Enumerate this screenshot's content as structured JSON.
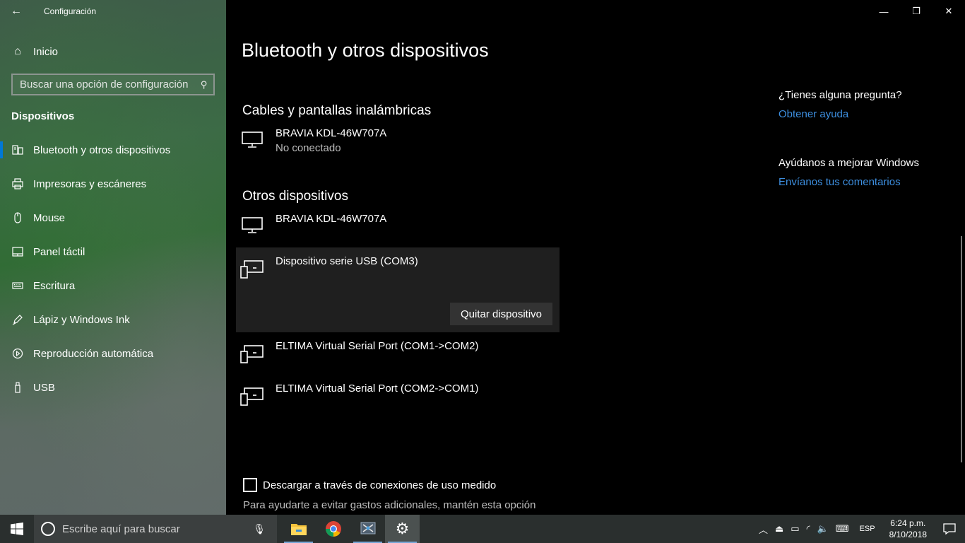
{
  "window": {
    "title": "Configuración",
    "back_icon": "←",
    "minimize_icon": "—",
    "maximize_icon": "❐",
    "close_icon": "✕"
  },
  "sidebar": {
    "home_label": "Inicio",
    "search_placeholder": "Buscar una opción de configuración",
    "section": "Dispositivos",
    "items": [
      {
        "label": "Bluetooth y otros dispositivos",
        "icon": "bluetooth-devices-icon",
        "active": true
      },
      {
        "label": "Impresoras y escáneres",
        "icon": "printer-icon"
      },
      {
        "label": "Mouse",
        "icon": "mouse-icon"
      },
      {
        "label": "Panel táctil",
        "icon": "touchpad-icon"
      },
      {
        "label": "Escritura",
        "icon": "keyboard-icon"
      },
      {
        "label": "Lápiz y Windows Ink",
        "icon": "pen-icon"
      },
      {
        "label": "Reproducción automática",
        "icon": "autoplay-icon"
      },
      {
        "label": "USB",
        "icon": "usb-icon"
      }
    ]
  },
  "main": {
    "title": "Bluetooth y otros dispositivos",
    "wireless_heading": "Cables y pantallas inalámbricas",
    "wireless_device": {
      "name": "BRAVIA KDL-46W707A",
      "status": "No conectado"
    },
    "other_heading": "Otros dispositivos",
    "other_devices": [
      {
        "name": "BRAVIA KDL-46W707A",
        "icon": "monitor-icon"
      },
      {
        "name": "Dispositivo serie USB (COM3)",
        "icon": "serial-device-icon",
        "selected": true
      },
      {
        "name": "ELTIMA Virtual Serial Port (COM1->COM2)",
        "icon": "serial-device-icon"
      },
      {
        "name": "ELTIMA Virtual Serial Port (COM2->COM1)",
        "icon": "serial-device-icon"
      }
    ],
    "remove_button": "Quitar dispositivo",
    "metered_checkbox_label": "Descargar a través de conexiones de uso medido",
    "metered_checkbox_checked": false,
    "metered_help": "Para ayudarte a evitar gastos adicionales, mantén esta opción"
  },
  "aside": {
    "question": "¿Tienes alguna pregunta?",
    "help_link": "Obtener ayuda",
    "improve": "Ayúdanos a mejorar Windows",
    "feedback_link": "Envíanos tus comentarios"
  },
  "taskbar": {
    "search_placeholder": "Escribe aquí para buscar",
    "language": "ESP",
    "time": "6:24 p.m.",
    "date": "8/10/2018",
    "accent_color": "#0078d7"
  }
}
